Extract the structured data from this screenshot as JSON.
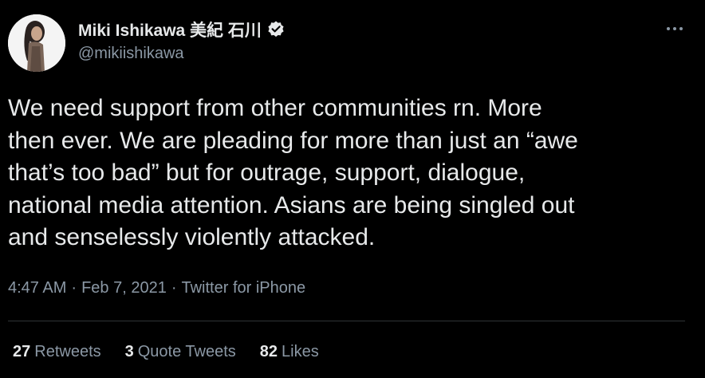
{
  "author": {
    "display_name": "Miki Ishikawa 美紀 石川",
    "handle": "@mikiishikawa",
    "verified": true,
    "avatar_icon": "profile-photo"
  },
  "more_icon": "more-horizontal-icon",
  "tweet": {
    "lines": [
      "We need support from other communities rn. More",
      "then ever. We are pleading for more than just an “awe",
      "that’s too bad” but for outrage, support, dialogue,",
      "national media attention. Asians are being singled out",
      "and senselessly violently attacked."
    ]
  },
  "meta": {
    "time": "4:47 AM",
    "separator": "·",
    "date": "Feb 7, 2021",
    "source": "Twitter for iPhone"
  },
  "stats": {
    "retweets_count": "27",
    "retweets_label": "Retweets",
    "quotes_count": "3",
    "quotes_label": "Quote Tweets",
    "likes_count": "82",
    "likes_label": "Likes"
  },
  "colors": {
    "background": "#000000",
    "primary_text": "#e7e9ea",
    "secondary_text": "#8b98a5",
    "divider": "#2f3336"
  }
}
